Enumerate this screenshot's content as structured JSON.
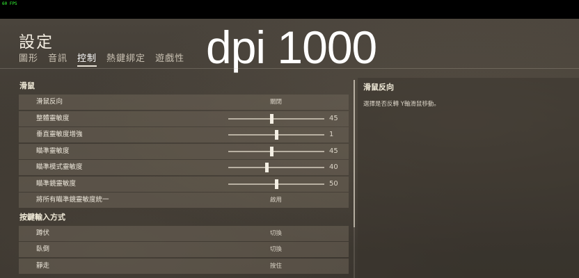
{
  "fps": "60 FPS",
  "settings": {
    "title": "設定",
    "tabs": [
      {
        "label": "圖形",
        "active": false
      },
      {
        "label": "音訊",
        "active": false
      },
      {
        "label": "控制",
        "active": true
      },
      {
        "label": "熱鍵綁定",
        "active": false
      },
      {
        "label": "遊戲性",
        "active": false
      }
    ]
  },
  "overlay_text": "dpi 1000",
  "mouse_section": {
    "title": "滑鼠",
    "rows": [
      {
        "label": "滑鼠反向",
        "type": "toggle",
        "value": "關閉"
      },
      {
        "label": "整體靈敏度",
        "type": "slider",
        "value": 45,
        "fraction": 0.45
      },
      {
        "label": "垂直靈敏度增強",
        "type": "slider",
        "value": 1,
        "fraction": 0.5
      },
      {
        "label": "瞄準靈敏度",
        "type": "slider",
        "value": 45,
        "fraction": 0.45
      },
      {
        "label": "瞄準模式靈敏度",
        "type": "slider",
        "value": 40,
        "fraction": 0.4
      },
      {
        "label": "瞄準鏡靈敏度",
        "type": "slider",
        "value": 50,
        "fraction": 0.5
      },
      {
        "label": "將所有瞄準鏡靈敏度統一",
        "type": "toggle",
        "value": "啟用"
      }
    ]
  },
  "input_section": {
    "title": "按鍵輸入方式",
    "rows": [
      {
        "label": "蹲伏",
        "type": "toggle",
        "value": "切換"
      },
      {
        "label": "臥倒",
        "type": "toggle",
        "value": "切換"
      },
      {
        "label": "靜走",
        "type": "toggle",
        "value": "按住"
      }
    ]
  },
  "description": {
    "title": "滑鼠反向",
    "body": "選擇是否反轉 Y軸滑鼠移動。"
  }
}
